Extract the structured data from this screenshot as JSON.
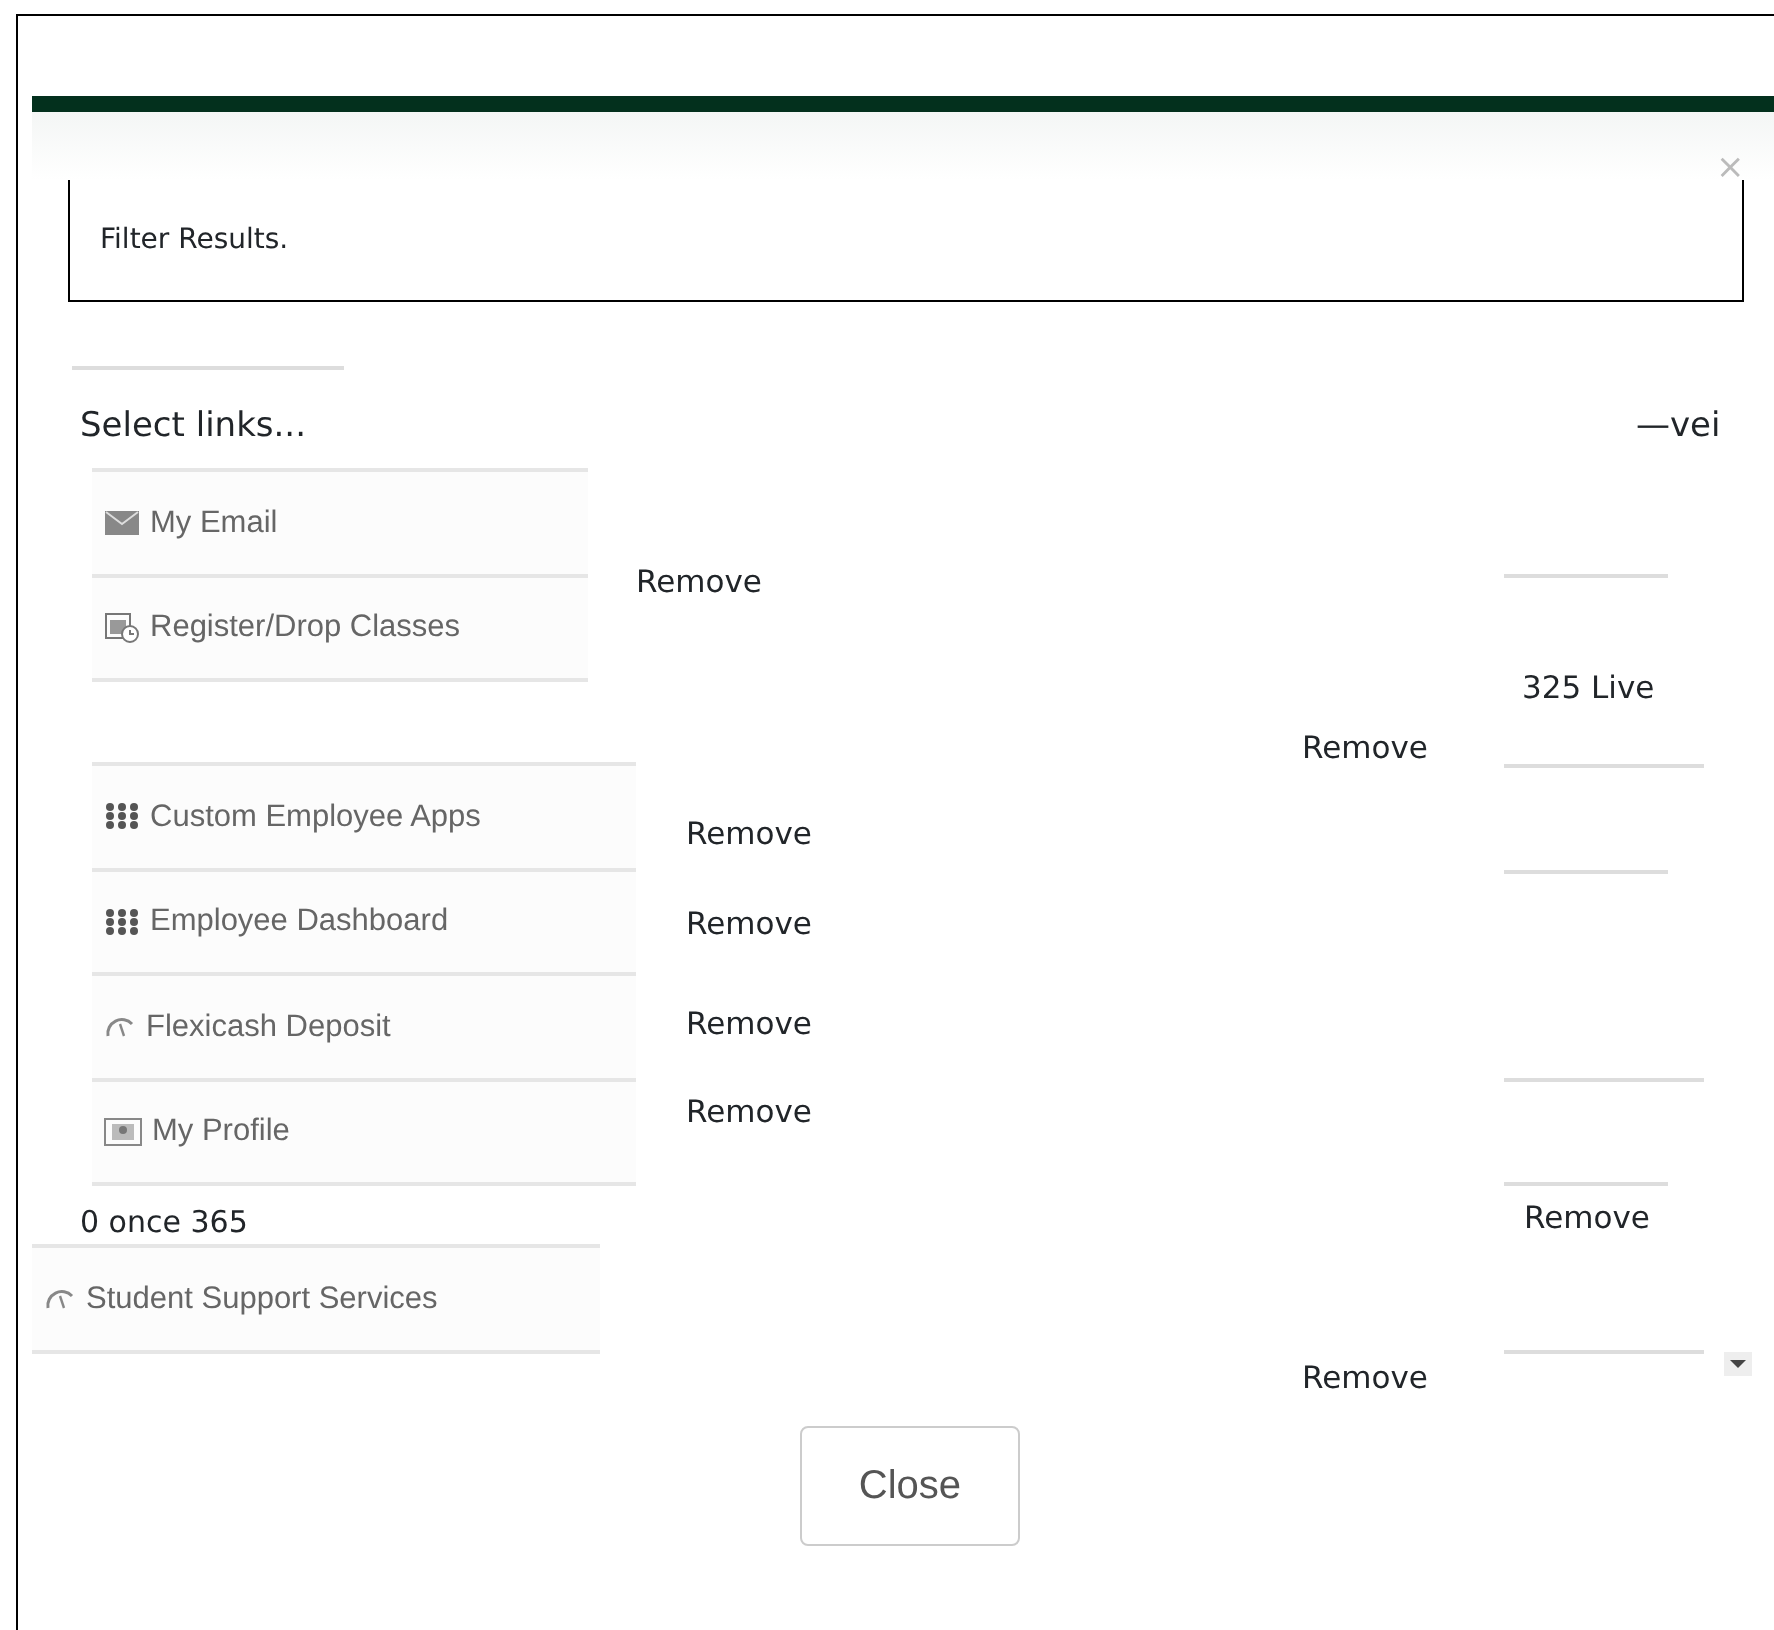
{
  "dialog": {
    "close_symbol": "×",
    "filter_text": "Filter Results.",
    "heading": "Select links...",
    "heading_side": "—vei",
    "link_groups": [
      {
        "links": [
          {
            "label": "My Email",
            "kind": "mail"
          },
          {
            "label": "Register/Drop Classes",
            "kind": "calendar"
          }
        ]
      },
      {
        "links": [
          {
            "label": "Custom Employee Apps",
            "kind": "apps"
          },
          {
            "label": "Employee Dashboard",
            "kind": "apps"
          },
          {
            "label": "Flexicash Deposit",
            "kind": "gauge"
          },
          {
            "label": "My Profile",
            "kind": "profile"
          }
        ]
      },
      {
        "links": [
          {
            "label": "Student Support Services",
            "kind": "gauge"
          }
        ]
      }
    ],
    "between_text": "0 once 365",
    "note_text": "325 Live",
    "remove_links": [
      "Remove",
      "Remove",
      "Remove",
      "Remove",
      "Remove",
      "Remove",
      "Remove",
      "Remove"
    ],
    "close_button": "Close"
  }
}
